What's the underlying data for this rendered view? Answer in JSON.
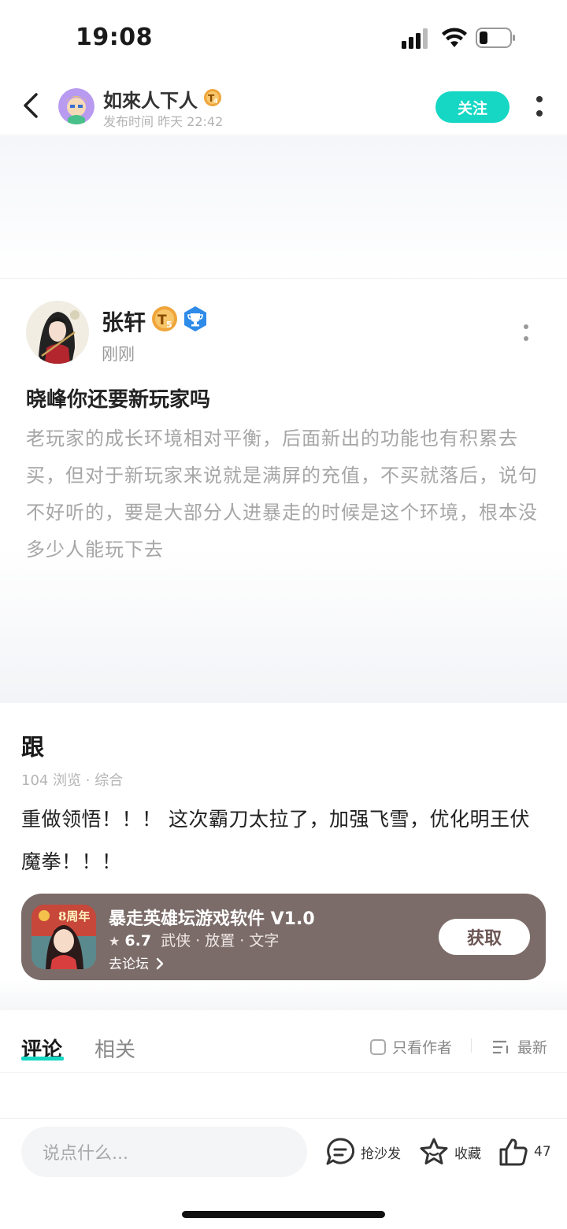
{
  "status_bar": {
    "time": "19:08"
  },
  "nav": {
    "author_name": "如來人下人",
    "badge": "T4",
    "publish_time": "发布时间 昨天 22:42",
    "follow_label": "关注"
  },
  "quote": {
    "author_name": "张轩",
    "badge": "T5",
    "time": "刚刚",
    "title": "晓峰你还要新玩家吗",
    "body": "老玩家的成长环境相对平衡，后面新出的功能也有积累去买，但对于新玩家来说就是满屏的充值，不买就落后，说句不好听的，要是大部分人进暴走的时候是这个环境，根本没多少人能玩下去"
  },
  "post": {
    "title": "跟",
    "meta": "104 浏览 · 综合",
    "body": "重做领悟！！！ 这次霸刀太拉了，加强飞雪，优化明王伏魔拳！！！"
  },
  "app_card": {
    "icon_label": "8周年",
    "name": "暴走英雄坛游戏软件 V1.0",
    "rating_star": "★",
    "rating": "6.7",
    "tags": "武侠 · 放置 · 文字",
    "forum_link": "去论坛",
    "get_label": "获取",
    "background_color": "#7b6c69"
  },
  "tabs": {
    "comment": "评论",
    "related": "相关",
    "only_author": "只看作者",
    "sort": "最新",
    "accent_color": "#15d7c4"
  },
  "bottom_bar": {
    "input_placeholder": "说点什么...",
    "sofa_label": "抢沙发",
    "favorite_label": "收藏",
    "like_count": "47"
  }
}
